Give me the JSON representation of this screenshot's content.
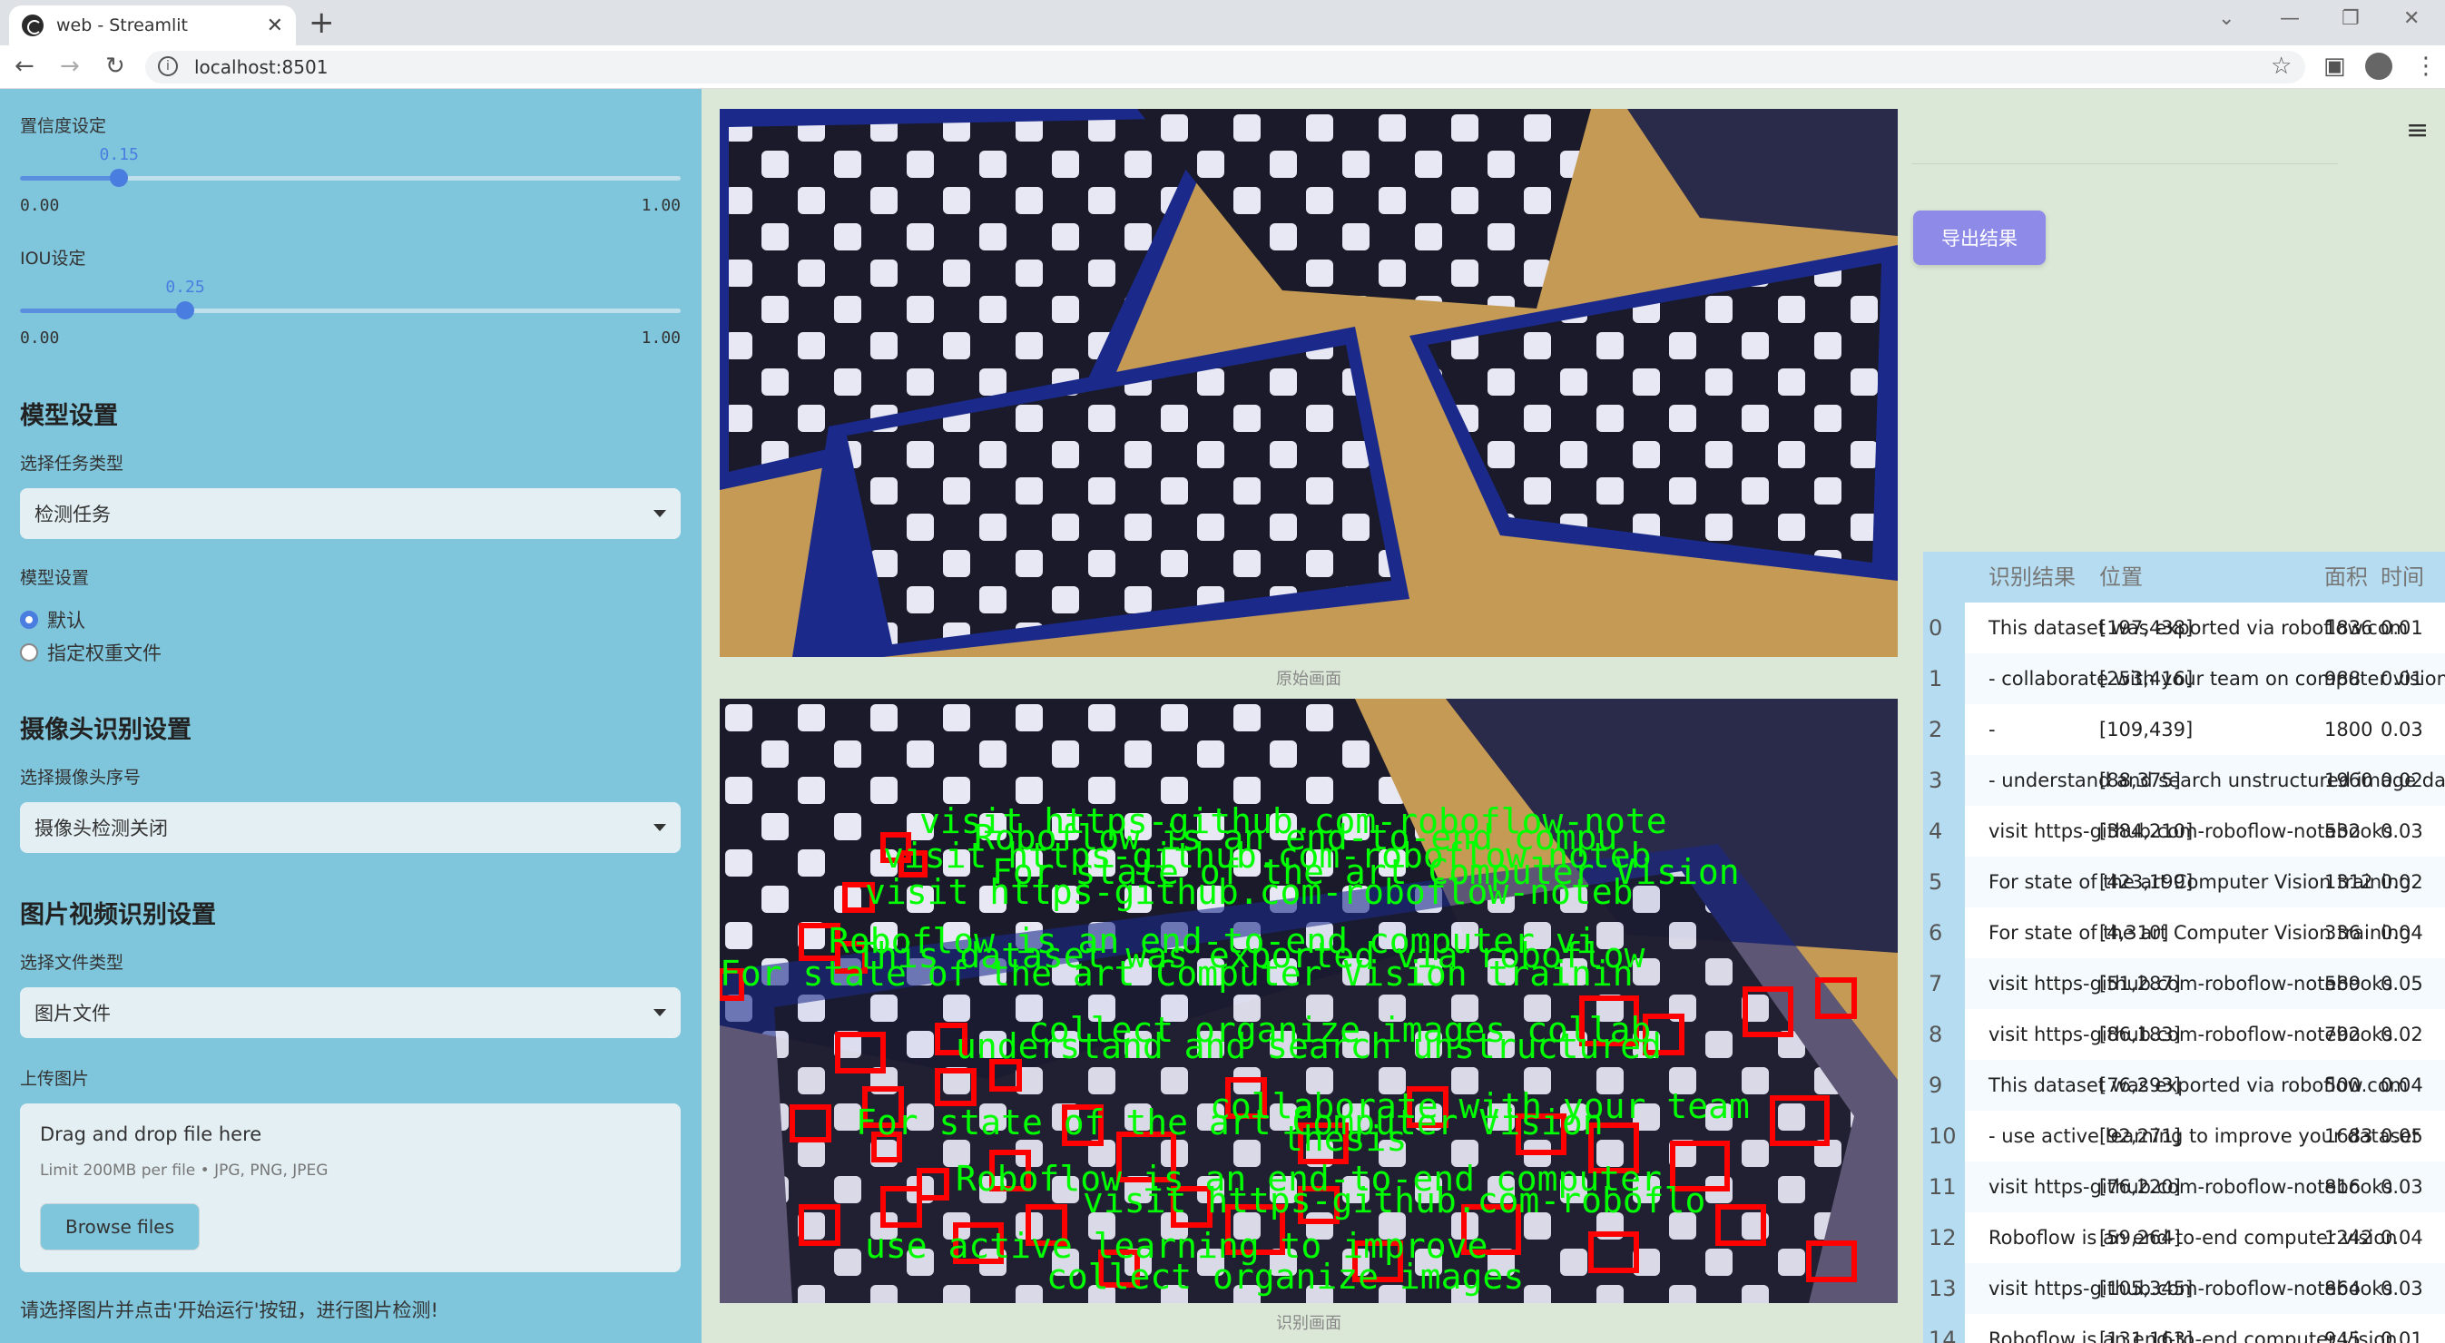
{
  "browser": {
    "tab_title": "web - Streamlit",
    "url": "localhost:8501"
  },
  "sidebar": {
    "confidence": {
      "label": "置信度设定",
      "value": "0.15",
      "fraction": 0.15,
      "min": "0.00",
      "max": "1.00"
    },
    "iou": {
      "label": "IOU设定",
      "value": "0.25",
      "fraction": 0.25,
      "min": "0.00",
      "max": "1.00"
    },
    "model_section": "模型设置",
    "task_type_label": "选择任务类型",
    "task_type_value": "检测任务",
    "model_label": "模型设置",
    "model_options": [
      "默认",
      "指定权重文件"
    ],
    "model_selected": 0,
    "camera_section": "摄像头识别设置",
    "camera_label": "选择摄像头序号",
    "camera_value": "摄像头检测关闭",
    "media_section": "图片视频识别设置",
    "file_type_label": "选择文件类型",
    "file_type_value": "图片文件",
    "upload_label": "上传图片",
    "upload_drag": "Drag and drop file here",
    "upload_limit": "Limit 200MB per file • JPG, PNG, JPEG",
    "browse_label": "Browse files",
    "hint": "请选择图片并点击'开始运行'按钮，进行图片检测!"
  },
  "main": {
    "original_caption": "原始画面",
    "result_caption": "识别画面",
    "export_label": "导出结果",
    "overlay_texts": [
      "visit https-github.com-roboflow-note",
      "Roboflow is an end-to-end compu",
      "visit https-github.com-roboflow-noteb",
      "For state of the art Computer Vision",
      "visit https-github.com-roboflow-noteb",
      "Roboflow is an end-to-end computer vi",
      "This dataset was exported via roboflow",
      "For state of the art Computer Vision trainin",
      "collect organize images collab",
      "understand and search unstructured",
      "collaborate with your team",
      "For state of the art Computer Vision",
      "thesis",
      "Roboflow is an end-to-end computer",
      "visit https-github.com-roboflo",
      "use active learning to improve",
      "collect organize images"
    ],
    "table": {
      "headers": [
        "",
        "识别结果",
        "位置",
        "面积",
        "时间"
      ],
      "rows": [
        [
          "0",
          "This dataset was exported via roboflow.com",
          "[197,438]",
          "1836",
          "0.01"
        ],
        [
          "1",
          "- collaborate with your team on computer vision",
          "[253,416]",
          "988",
          "0.01"
        ],
        [
          "2",
          "-",
          "[109,439]",
          "1800",
          "0.03"
        ],
        [
          "3",
          "- understand and search unstructured image data",
          "[88,375]",
          "1960",
          "0.02"
        ],
        [
          "4",
          "visit https-github.com-roboflow-notebooks",
          "[384,210]",
          "532",
          "0.03"
        ],
        [
          "5",
          "For state of the art Computer Vision training",
          "[423,199]",
          "1312",
          "0.02"
        ],
        [
          "6",
          "For state of the art Computer Vision training",
          "[4,310]",
          "336",
          "0.04"
        ],
        [
          "7",
          "visit https-github.com-roboflow-notebooks",
          "[51,287]",
          "589",
          "0.05"
        ],
        [
          "8",
          "visit https-github.com-roboflow-notebooks",
          "[86,183]",
          "792",
          "0.02"
        ],
        [
          "9",
          "This dataset was exported via roboflow.com",
          "[76,293]",
          "500",
          "0.04"
        ],
        [
          "10",
          "- use active learning to improve your dataset",
          "[92,271]",
          "1683",
          "0.05"
        ],
        [
          "11",
          "visit https-github.com-roboflow-notebooks",
          "[76,220]",
          "816",
          "0.03"
        ],
        [
          "12",
          "Roboflow is an end-to-end computer vision",
          "[59,264]",
          "1242",
          "0.04"
        ],
        [
          "13",
          "visit https-github.com-roboflow-notebooks",
          "[105,345]",
          "864",
          "0.03"
        ],
        [
          "14",
          "Roboflow is an end-to-end computer vision",
          "[131,163]",
          "945",
          "0.01"
        ]
      ]
    }
  },
  "colors": {
    "sidebar_bg": "#7fc6dc",
    "main_bg": "#dbe8d7",
    "accent": "#4a7de0",
    "export_btn": "#8d8ae8",
    "table_header": "#b5dcf0",
    "detect_box": "#ff0000",
    "detect_text": "#00ff00"
  }
}
